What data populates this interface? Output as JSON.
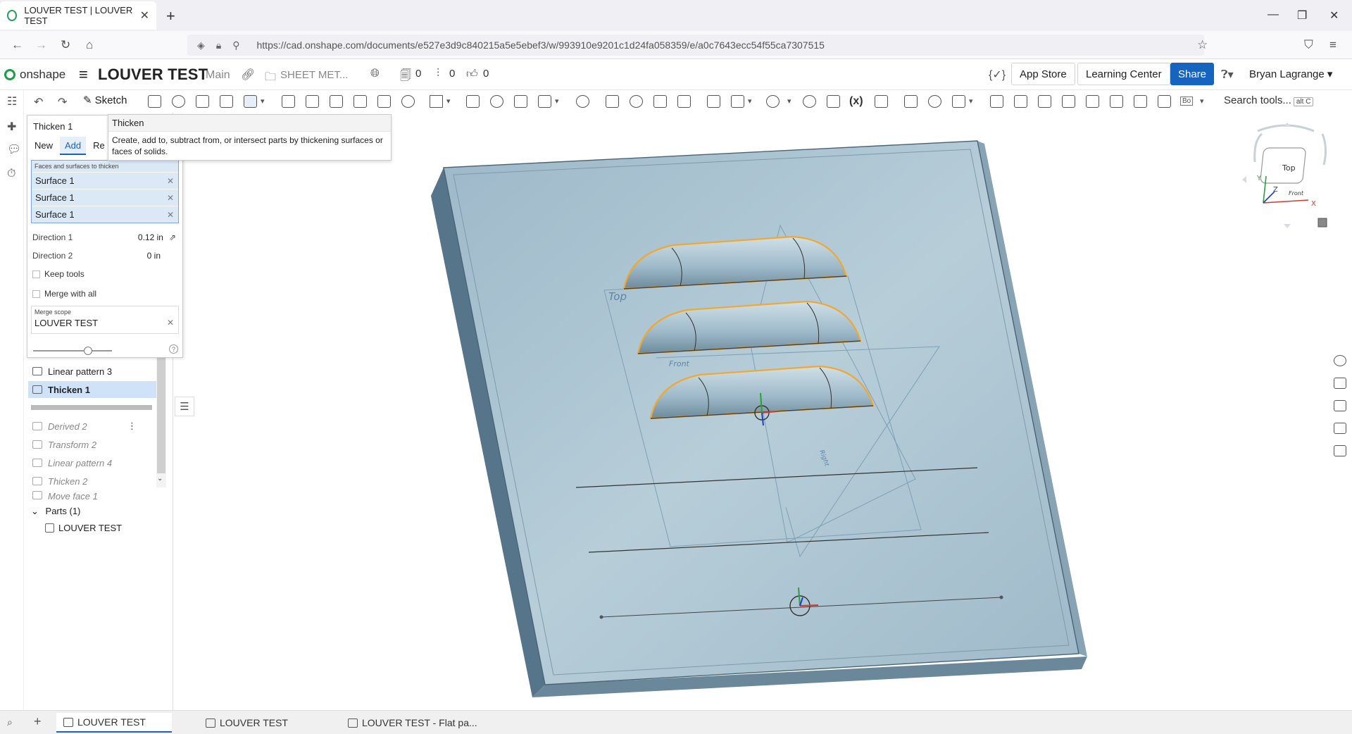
{
  "browser": {
    "tab_title": "LOUVER TEST | LOUVER TEST",
    "url": "https://cad.onshape.com/documents/e527e3d9c840215a5e5ebef3/w/993910e9201c1d24fa058359/e/a0c7643ecc54f55ca7307515"
  },
  "header": {
    "logo": "onshape",
    "document_title": "LOUVER TEST",
    "workspace": "Main",
    "folder": "SHEET MET...",
    "counters": [
      "0",
      "0",
      "0"
    ],
    "app_store": "App Store",
    "learning_center": "Learning Center",
    "share": "Share",
    "user": "Bryan Lagrange"
  },
  "toolbar": {
    "sketch": "Sketch",
    "search_tools": "Search tools...",
    "search_shortcut": "alt C",
    "bo": "Bo",
    "fx": "(x)"
  },
  "tooltip": {
    "title": "Thicken",
    "body": "Create, add to, subtract from, or intersect parts by thickening surfaces or faces of solids."
  },
  "dialog": {
    "title": "Thicken 1",
    "tabs": [
      "New",
      "Add",
      "Re"
    ],
    "selection_caption": "Faces and surfaces to thicken",
    "selections": [
      "Surface 1",
      "Surface 1",
      "Surface 1"
    ],
    "direction1_label": "Direction 1",
    "direction1_value": "0.12 in",
    "direction2_label": "Direction 2",
    "direction2_value": "0 in",
    "keep_tools": "Keep tools",
    "merge_with_all": "Merge with all",
    "merge_scope_caption": "Merge scope",
    "merge_scope_value": "LOUVER TEST",
    "help": "?"
  },
  "features": {
    "before_rollback": [
      {
        "label": "Linear pattern 3",
        "selected": false
      },
      {
        "label": "Thicken 1",
        "selected": true
      }
    ],
    "after_rollback": [
      "Derived 2",
      "Transform 2",
      "Linear pattern 4",
      "Thicken 2",
      "Move face 1"
    ]
  },
  "parts": {
    "header": "Parts (1)",
    "items": [
      "LOUVER TEST"
    ]
  },
  "viewport": {
    "plane_top": "Top",
    "plane_front": "Front",
    "plane_right": "Right",
    "viewcube_face": "Top",
    "viewcube_front": "Front",
    "axis_x": "X",
    "axis_y": "Y",
    "axis_z": "Z"
  },
  "bottom_tabs": [
    "LOUVER TEST",
    "LOUVER TEST",
    "LOUVER TEST - Flat pa..."
  ],
  "colors": {
    "accent": "#1565c0",
    "selection_highlight": "#f0a830",
    "part_face": "#a8c3d3",
    "part_edge": "#5f7f93"
  }
}
